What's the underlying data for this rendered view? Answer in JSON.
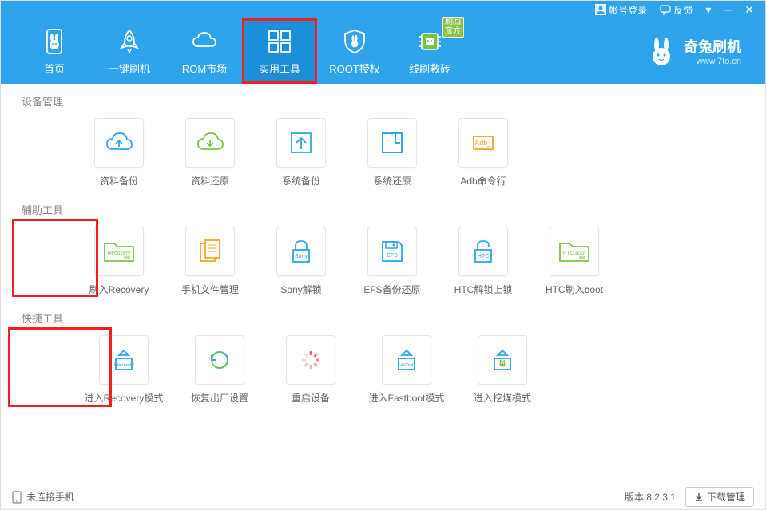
{
  "titlebar": {
    "login": "帐号登录",
    "feedback": "反馈"
  },
  "nav": [
    {
      "label": "首页"
    },
    {
      "label": "一键刷机"
    },
    {
      "label": "ROM市场"
    },
    {
      "label": "实用工具"
    },
    {
      "label": "ROOT授权"
    },
    {
      "label": "线刷救砖",
      "badge": "刷回官方"
    }
  ],
  "logo": {
    "main": "奇兔刷机",
    "sub": "www.7to.cn"
  },
  "sections": {
    "device": {
      "title": "设备管理",
      "items": [
        {
          "label": "资料备份"
        },
        {
          "label": "资料还原"
        },
        {
          "label": "系统备份"
        },
        {
          "label": "系统还原"
        },
        {
          "label": "Adb命令行"
        }
      ]
    },
    "assist": {
      "title": "辅助工具",
      "items": [
        {
          "label": "刷入Recovery",
          "sub": "Recovery"
        },
        {
          "label": "手机文件管理"
        },
        {
          "label": "Sony解锁",
          "sub": "Sony"
        },
        {
          "label": "EFS备份还原",
          "sub": "EFS"
        },
        {
          "label": "HTC解锁上锁",
          "sub": "HTC"
        },
        {
          "label": "HTC刷入boot",
          "sub": "HTC-boot"
        }
      ]
    },
    "quick": {
      "title": "快捷工具",
      "items": [
        {
          "label": "进入Recovery模式",
          "sub": "Recovery"
        },
        {
          "label": "恢复出厂设置"
        },
        {
          "label": "重启设备"
        },
        {
          "label": "进入Fastboot模式",
          "sub": "Fastboot"
        },
        {
          "label": "进入挖煤模式"
        }
      ]
    }
  },
  "statusbar": {
    "disconnected": "未连接手机",
    "version": "版本:8.2.3.1",
    "download": "下载管理"
  },
  "colors": {
    "primary": "#2fa4ed",
    "green": "#7cc344",
    "orange": "#f5a623",
    "red": "#f02020"
  }
}
